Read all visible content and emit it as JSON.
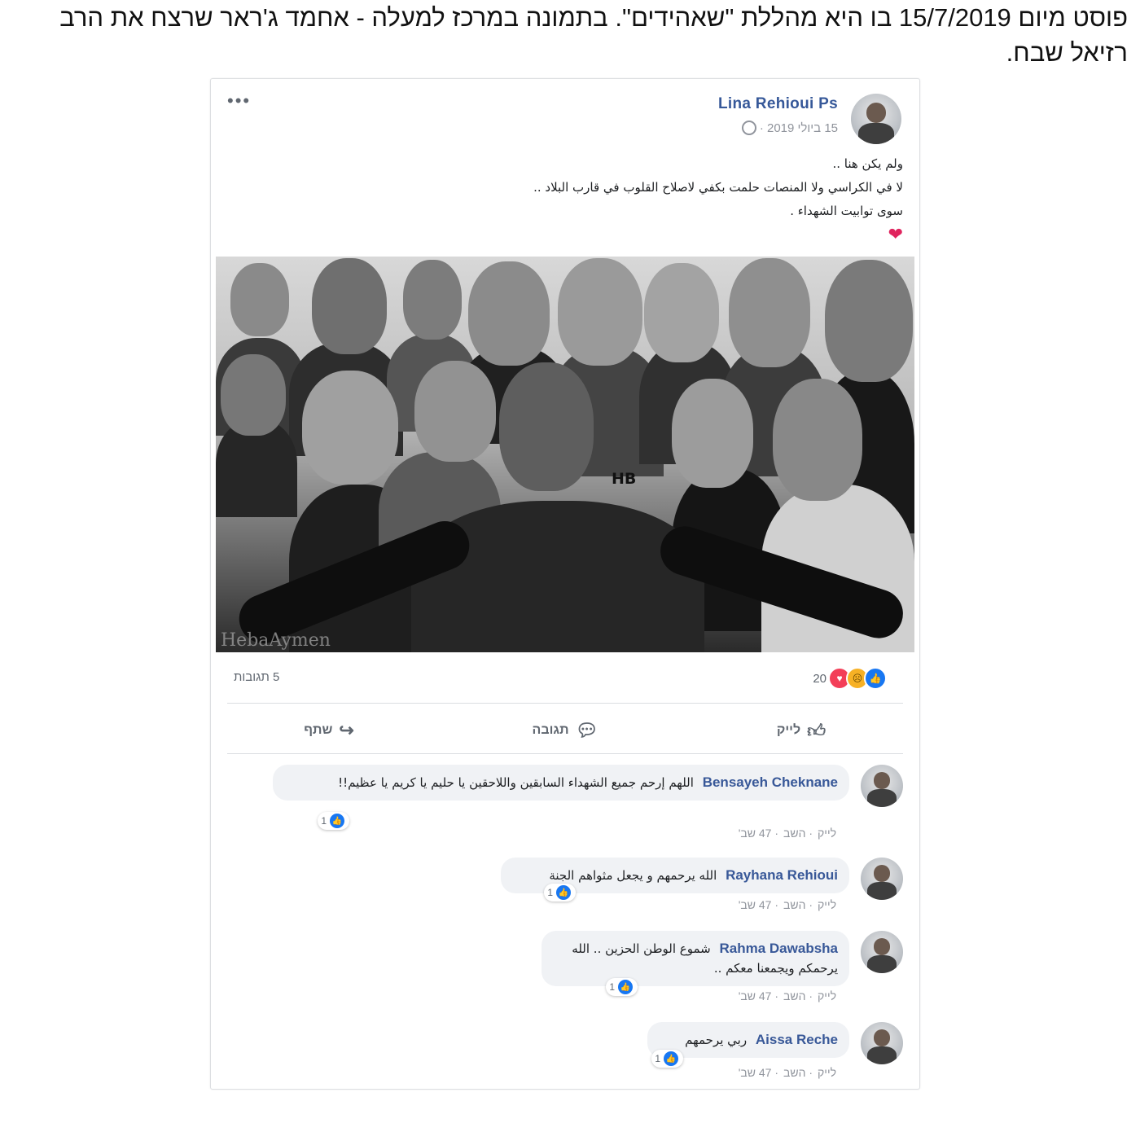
{
  "caption": "פוסט מיום 15/7/2019 בו היא מהללת \"שאהידים\". בתמונה במרכז למעלה - אחמד ג'ראר שרצח את הרב רזיאל שבח.",
  "post": {
    "author": "Lina Rehioui Ps",
    "date": "15 ביולי 2019 ·",
    "more_label": "•••",
    "text_lines": [
      "ولم يكن هنا ..",
      "لا في الكراسي ولا المنصات حلمت بكفي لاصلاح القلوب في قارب البلاد ..",
      "سوى توابيت الشهداء ."
    ],
    "heart": "❤",
    "image_watermark": "HebaAymen",
    "image_mark": "HB"
  },
  "stats": {
    "reaction_count": "20",
    "comments_count": "5 תגובות"
  },
  "actions": {
    "like": "לייק",
    "comment": "תגובה",
    "share": "שתף"
  },
  "comments": [
    {
      "name": "Bensayeh Cheknane",
      "text": "اللهم إرحم جميع الشهداء السابقين واللاحقين يا حليم يا كريم يا عظيم!!",
      "reactions": "1",
      "meta_like": "לייק",
      "meta_reply": "השב",
      "meta_time": "47 שב'"
    },
    {
      "name": "Rayhana Rehioui",
      "text": "الله يرحمهم و يجعل مثواهم الجنة",
      "reactions": "1",
      "meta_like": "לייק",
      "meta_reply": "השב",
      "meta_time": "47 שב'"
    },
    {
      "name": "Rahma Dawabsha",
      "text": "شموع الوطن الحزين .. الله يرحمكم ويجمعنا معكم ..",
      "reactions": "1",
      "meta_like": "לייק",
      "meta_reply": "השב",
      "meta_time": "47 שב'"
    },
    {
      "name": "Aissa Reche",
      "text": "ربي يرحمهم",
      "reactions": "1",
      "meta_like": "לייק",
      "meta_reply": "השב",
      "meta_time": "47 שב'"
    }
  ],
  "colors": {
    "link": "#365899",
    "like_blue": "#1877f2",
    "love_red": "#f33e58",
    "sad_yellow": "#f7b125",
    "bubble_bg": "#f0f2f5"
  }
}
